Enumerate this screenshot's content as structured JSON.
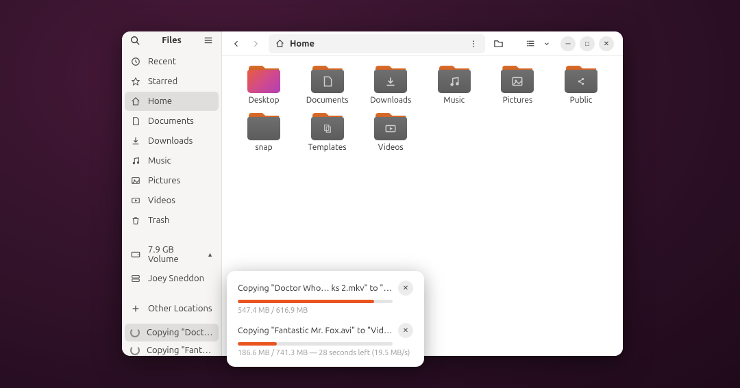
{
  "app_title": "Files",
  "path": {
    "location": "Home"
  },
  "sidebar": {
    "items": [
      {
        "id": "recent",
        "label": "Recent",
        "icon": "clock"
      },
      {
        "id": "starred",
        "label": "Starred",
        "icon": "star"
      },
      {
        "id": "home",
        "label": "Home",
        "icon": "home",
        "active": true
      },
      {
        "id": "documents",
        "label": "Documents",
        "icon": "doc"
      },
      {
        "id": "downloads",
        "label": "Downloads",
        "icon": "download"
      },
      {
        "id": "music",
        "label": "Music",
        "icon": "music"
      },
      {
        "id": "pictures",
        "label": "Pictures",
        "icon": "image"
      },
      {
        "id": "videos",
        "label": "Videos",
        "icon": "video"
      },
      {
        "id": "trash",
        "label": "Trash",
        "icon": "trash"
      }
    ],
    "volume": {
      "label": "7.9 GB Volume"
    },
    "user": {
      "label": "Joey Sneddon"
    },
    "other": {
      "label": "Other Locations"
    }
  },
  "folders": [
    {
      "name": "Desktop",
      "glyph": "",
      "special": "desktop"
    },
    {
      "name": "Documents",
      "glyph": "doc"
    },
    {
      "name": "Downloads",
      "glyph": "download"
    },
    {
      "name": "Music",
      "glyph": "music"
    },
    {
      "name": "Pictures",
      "glyph": "image"
    },
    {
      "name": "Public",
      "glyph": "share"
    },
    {
      "name": "snap",
      "glyph": ""
    },
    {
      "name": "Templates",
      "glyph": "template"
    },
    {
      "name": "Videos",
      "glyph": "video"
    }
  ],
  "operations": {
    "sidebar": [
      {
        "label": "Copying \"Doctor …",
        "selected": true
      },
      {
        "label": "Copying \"Fantastic…",
        "selected": false
      }
    ],
    "popover": [
      {
        "title": "Copying \"Doctor Who… ks 2.mkv\" to \"Videos\"",
        "progress_pct": 88,
        "sub": "547.4 MB / 616.9 MB"
      },
      {
        "title": "Copying \"Fantastic Mr. Fox.avi\" to \"Videos\"",
        "progress_pct": 25,
        "sub": "186.6 MB / 741.3 MB — 28 seconds left (19.5 MB/s)"
      }
    ]
  }
}
